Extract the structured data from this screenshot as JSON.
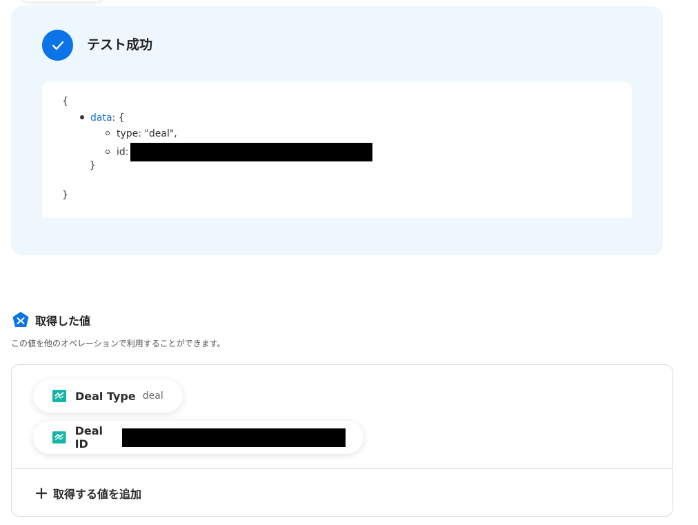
{
  "result": {
    "title": "テスト成功",
    "json_lines": {
      "open_brace": "{",
      "data_key": "data",
      "data_open": ": {",
      "type_line": "type: \"deal\",",
      "id_label": "id:",
      "inner_close": "}",
      "close_brace": "}"
    }
  },
  "values_section": {
    "title": "取得した値",
    "description": "この値を他のオペレーションで利用することができます。",
    "items": [
      {
        "label": "Deal Type",
        "value": "deal"
      },
      {
        "label": "Deal ID",
        "value": ""
      }
    ],
    "add_label": "取得する値を追加"
  },
  "colors": {
    "accent": "#0a74e8",
    "panel_bg": "#eef6fe",
    "app_icon": "#12b5a6"
  },
  "icons": {
    "success": "check-icon",
    "section": "yoom-icon",
    "app": "app-logo-icon",
    "add": "plus-icon"
  }
}
